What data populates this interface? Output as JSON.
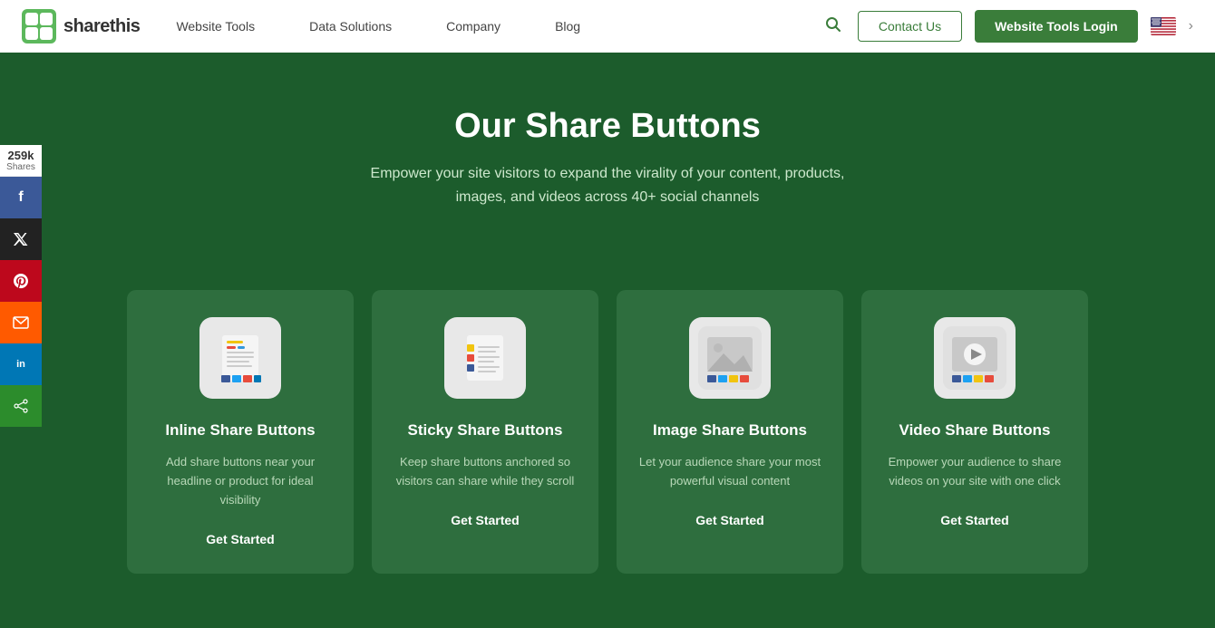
{
  "nav": {
    "logo_text": "sharethis",
    "links": [
      {
        "label": "Website Tools",
        "id": "website-tools"
      },
      {
        "label": "Data Solutions",
        "id": "data-solutions"
      },
      {
        "label": "Company",
        "id": "company"
      },
      {
        "label": "Blog",
        "id": "blog"
      }
    ],
    "contact_label": "Contact Us",
    "login_label": "Website Tools Login"
  },
  "share_counter": {
    "count": "259k",
    "label": "Shares"
  },
  "social_buttons": [
    {
      "id": "facebook",
      "symbol": "f",
      "class": "fb"
    },
    {
      "id": "twitter",
      "symbol": "𝕏",
      "class": "tw"
    },
    {
      "id": "pinterest",
      "symbol": "P",
      "class": "pi"
    },
    {
      "id": "email",
      "symbol": "✉",
      "class": "em"
    },
    {
      "id": "linkedin",
      "symbol": "in",
      "class": "li"
    },
    {
      "id": "share",
      "symbol": "⤢",
      "class": "sh"
    }
  ],
  "hero": {
    "title": "Our Share Buttons",
    "subtitle": "Empower your site visitors to expand the virality of your content, products, images, and videos across 40+ social channels"
  },
  "cards": [
    {
      "id": "inline",
      "title": "Inline Share Buttons",
      "desc": "Add share buttons near your headline or product for ideal visibility",
      "cta": "Get Started"
    },
    {
      "id": "sticky",
      "title": "Sticky Share Buttons",
      "desc": "Keep share buttons anchored so visitors can share while they scroll",
      "cta": "Get Started"
    },
    {
      "id": "image",
      "title": "Image Share Buttons",
      "desc": "Let your audience share your most powerful visual content",
      "cta": "Get Started"
    },
    {
      "id": "video",
      "title": "Video Share Buttons",
      "desc": "Empower your audience to share videos on your site with one click",
      "cta": "Get Started"
    }
  ]
}
